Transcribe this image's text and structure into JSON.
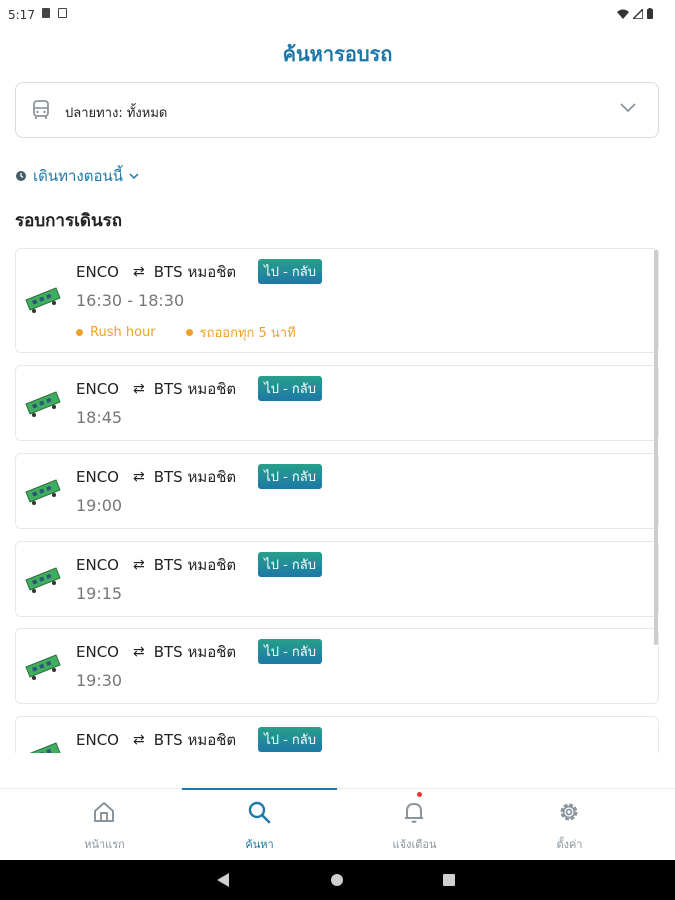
{
  "status_bar": {
    "time": "5:17"
  },
  "header": {
    "title": "ค้นหารอบรถ"
  },
  "destination": {
    "label": "ปลายทาง: ทั้งหมด"
  },
  "depart": {
    "label": "เดินทางตอนนี้"
  },
  "section": {
    "title": "รอบการเดินรถ"
  },
  "trips": [
    {
      "origin": "ENCO",
      "arrow": "⇄",
      "dest": "BTS หมอชิต",
      "badge": "ไป - กลับ",
      "time": "16:30 - 18:30",
      "tags": [
        "Rush hour",
        "รถออกทุก 5 นาที"
      ]
    },
    {
      "origin": "ENCO",
      "arrow": "⇄",
      "dest": "BTS หมอชิต",
      "badge": "ไป - กลับ",
      "time": "18:45"
    },
    {
      "origin": "ENCO",
      "arrow": "⇄",
      "dest": "BTS หมอชิต",
      "badge": "ไป - กลับ",
      "time": "19:00"
    },
    {
      "origin": "ENCO",
      "arrow": "⇄",
      "dest": "BTS หมอชิต",
      "badge": "ไป - กลับ",
      "time": "19:15"
    },
    {
      "origin": "ENCO",
      "arrow": "⇄",
      "dest": "BTS หมอชิต",
      "badge": "ไป - กลับ",
      "time": "19:30"
    },
    {
      "origin": "ENCO",
      "arrow": "⇄",
      "dest": "BTS หมอชิต",
      "badge": "ไป - กลับ",
      "time": ""
    }
  ],
  "bottom_nav": {
    "items": [
      {
        "label": "หน้าแรก",
        "icon": "home-icon"
      },
      {
        "label": "ค้นหา",
        "icon": "search-icon",
        "active": true
      },
      {
        "label": "แจ้งเตือน",
        "icon": "bell-icon"
      },
      {
        "label": "ตั้งค่า",
        "icon": "gear-icon"
      }
    ]
  },
  "colors": {
    "accent": "#1d78a8",
    "badge_start": "#27a08a",
    "tag": "#f0a028",
    "train": "#3fae5f"
  }
}
